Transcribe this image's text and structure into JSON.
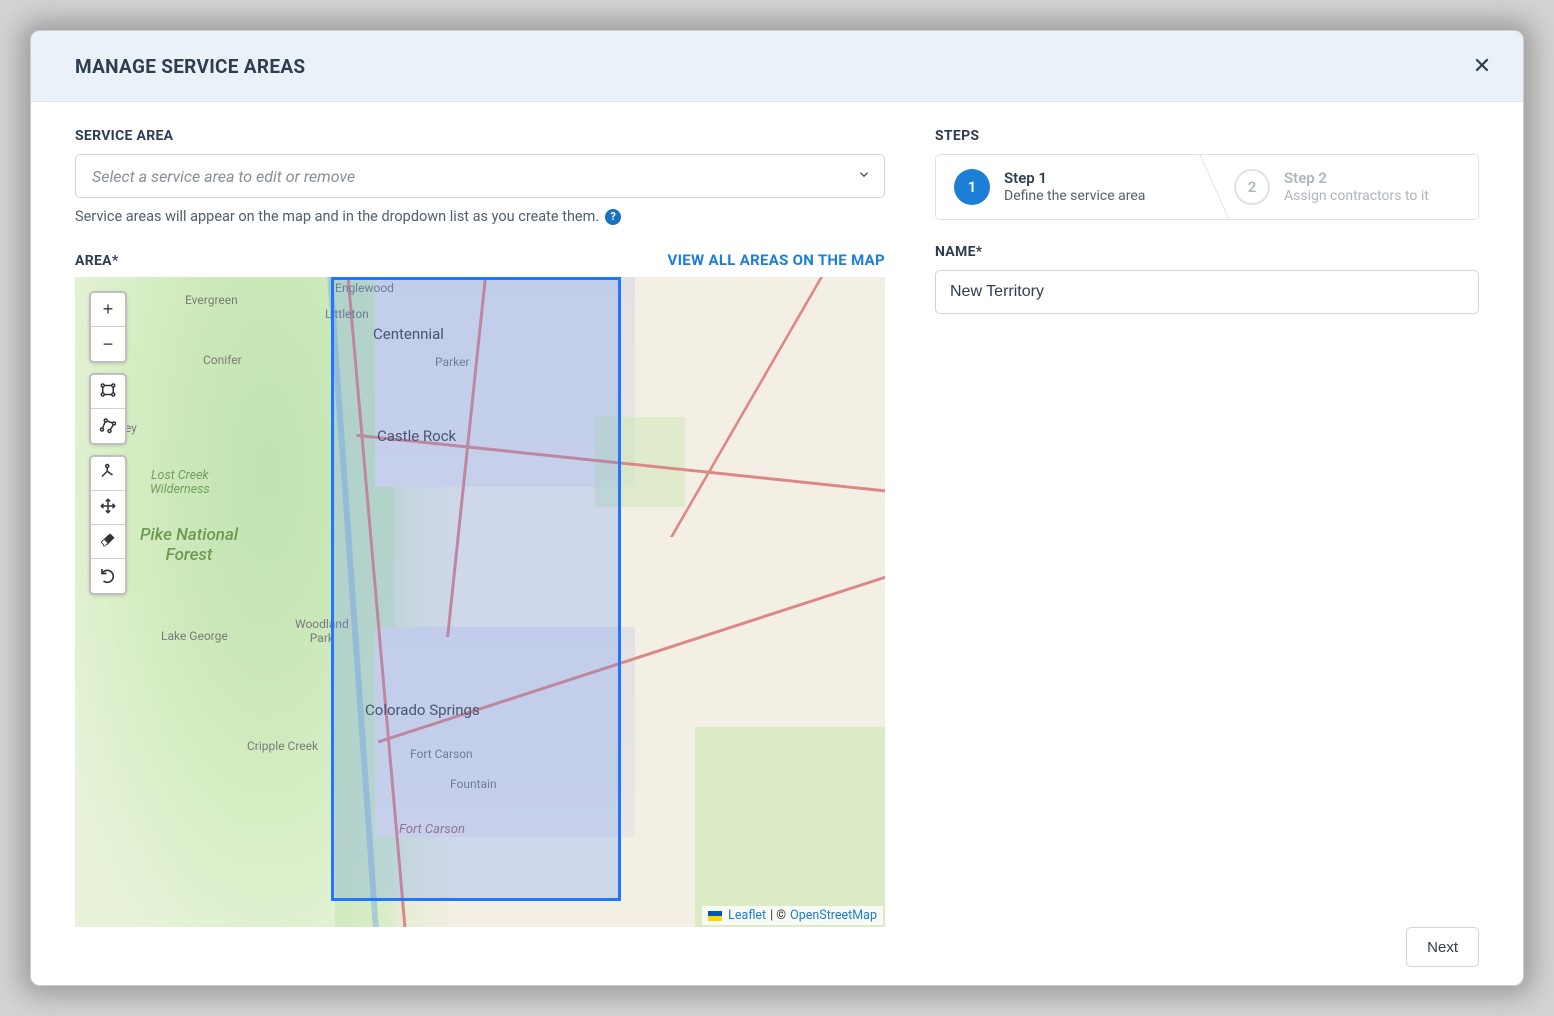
{
  "header": {
    "title": "MANAGE SERVICE AREAS"
  },
  "left": {
    "service_area_label": "SERVICE AREA",
    "service_area_placeholder": "Select a service area to edit or remove",
    "service_area_hint": "Service areas will appear on the map and in the dropdown list as you create them.",
    "area_label": "AREA*",
    "view_all_link": "VIEW ALL AREAS ON THE MAP"
  },
  "map": {
    "attribution_leaflet": "Leaflet",
    "attribution_sep": " | © ",
    "attribution_osm": "OpenStreetMap",
    "labels": {
      "evergreen": "Evergreen",
      "englewood": "Englewood",
      "littleton": "Littleton",
      "centennial": "Centennial",
      "conifer": "Conifer",
      "parker": "Parker",
      "bailey": "Bailey",
      "lost_creek": "Lost Creek\nWilderness",
      "pike_forest": "Pike National\nForest",
      "castle_rock": "Castle Rock",
      "lake_george": "Lake George",
      "woodland_park": "Woodland\nPark",
      "colorado_springs": "Colorado Springs",
      "cripple_creek": "Cripple Creek",
      "fort_carson": "Fort Carson",
      "fountain": "Fountain",
      "fort_carson_area": "Fort Carson"
    }
  },
  "right": {
    "steps_label": "STEPS",
    "steps": [
      {
        "num": "1",
        "title": "Step 1",
        "desc": "Define the service area"
      },
      {
        "num": "2",
        "title": "Step 2",
        "desc": "Assign contractors to it"
      }
    ],
    "name_label": "NAME*",
    "name_value": "New Territory",
    "next_button": "Next"
  }
}
